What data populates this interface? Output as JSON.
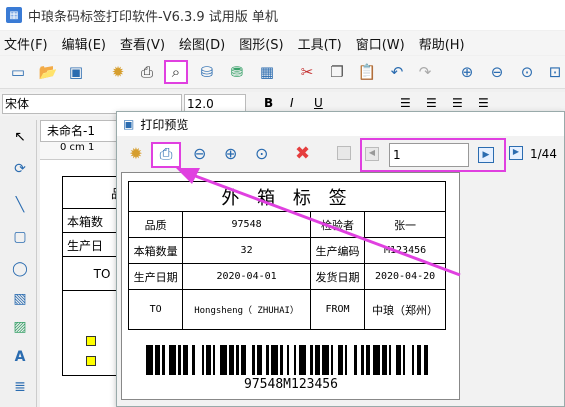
{
  "app": {
    "title": "中琅条码标签打印软件-V6.3.9 试用版 单机"
  },
  "menu": [
    "文件(F)",
    "编辑(E)",
    "查看(V)",
    "绘图(D)",
    "图形(S)",
    "工具(T)",
    "窗口(W)",
    "帮助(H)"
  ],
  "fontbar": {
    "font_name": "宋体",
    "font_size": "12.0",
    "bold": "B",
    "italic": "I",
    "underline": "U"
  },
  "doc_tab": {
    "label": "未命名-1"
  },
  "canvas_bg": {
    "ruler": "0 cm 1",
    "rows": [
      "品质",
      "本箱数",
      "生产日",
      "TO"
    ]
  },
  "dialog": {
    "title": "打印预览",
    "page_input": "1",
    "page_total": "1/44",
    "label": {
      "title": "外 箱 标 签",
      "row1": [
        "品质",
        "97548",
        "检验者",
        "张一"
      ],
      "row2": [
        "本箱数量",
        "32",
        "生产编码",
        "M123456"
      ],
      "row3": [
        "生产日期",
        "2020-04-01",
        "发货日期",
        "2020-04-20"
      ],
      "row4": [
        "TO",
        "Hongsheng（ ZHUHAI）",
        "FROM",
        "中琅（郑州）"
      ],
      "barcode_text": "97548M123456"
    }
  },
  "colors": {
    "highlight": "#e040e0",
    "arrow": "#e040e0"
  }
}
